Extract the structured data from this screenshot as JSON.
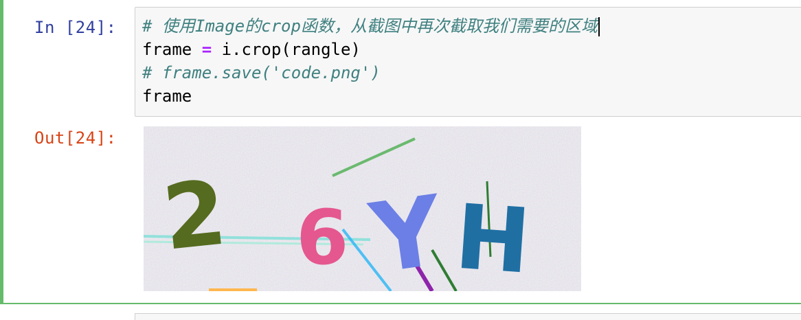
{
  "cell": {
    "in_prompt": "In [24]:",
    "out_prompt": "Out[24]:"
  },
  "code": {
    "line1": "# 使用Image的crop函数，从截图中再次截取我们需要的区域",
    "line2_var": "frame",
    "line2_op": "=",
    "line2_expr": "i.crop(rangle)",
    "line3": "# frame.save('code.png')",
    "line4": "frame"
  },
  "output": {
    "captcha_chars": [
      "2",
      "6",
      "Y",
      "H"
    ]
  },
  "colors": {
    "in_prompt": "#303f9f",
    "out_prompt": "#d84315",
    "comment": "#408080",
    "operator": "#aa22ff",
    "cell_border": "#66bb6a"
  }
}
